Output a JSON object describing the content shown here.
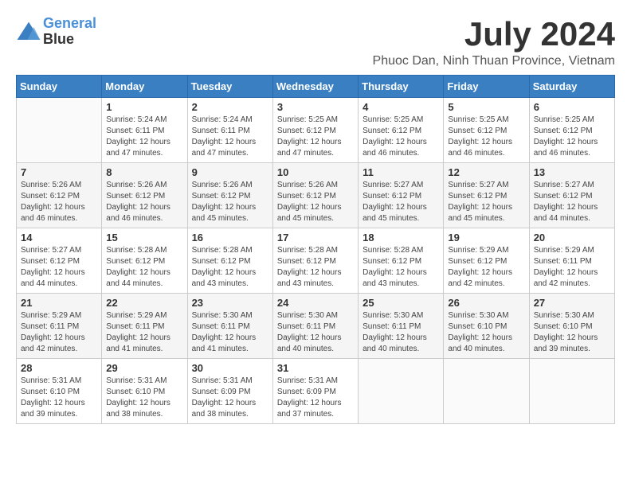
{
  "logo": {
    "line1": "General",
    "line2": "Blue"
  },
  "title": {
    "month_year": "July 2024",
    "location": "Phuoc Dan, Ninh Thuan Province, Vietnam"
  },
  "days_of_week": [
    "Sunday",
    "Monday",
    "Tuesday",
    "Wednesday",
    "Thursday",
    "Friday",
    "Saturday"
  ],
  "weeks": [
    [
      {
        "day": "",
        "info": ""
      },
      {
        "day": "1",
        "info": "Sunrise: 5:24 AM\nSunset: 6:11 PM\nDaylight: 12 hours\nand 47 minutes."
      },
      {
        "day": "2",
        "info": "Sunrise: 5:24 AM\nSunset: 6:11 PM\nDaylight: 12 hours\nand 47 minutes."
      },
      {
        "day": "3",
        "info": "Sunrise: 5:25 AM\nSunset: 6:12 PM\nDaylight: 12 hours\nand 47 minutes."
      },
      {
        "day": "4",
        "info": "Sunrise: 5:25 AM\nSunset: 6:12 PM\nDaylight: 12 hours\nand 46 minutes."
      },
      {
        "day": "5",
        "info": "Sunrise: 5:25 AM\nSunset: 6:12 PM\nDaylight: 12 hours\nand 46 minutes."
      },
      {
        "day": "6",
        "info": "Sunrise: 5:25 AM\nSunset: 6:12 PM\nDaylight: 12 hours\nand 46 minutes."
      }
    ],
    [
      {
        "day": "7",
        "info": "Sunrise: 5:26 AM\nSunset: 6:12 PM\nDaylight: 12 hours\nand 46 minutes."
      },
      {
        "day": "8",
        "info": "Sunrise: 5:26 AM\nSunset: 6:12 PM\nDaylight: 12 hours\nand 46 minutes."
      },
      {
        "day": "9",
        "info": "Sunrise: 5:26 AM\nSunset: 6:12 PM\nDaylight: 12 hours\nand 45 minutes."
      },
      {
        "day": "10",
        "info": "Sunrise: 5:26 AM\nSunset: 6:12 PM\nDaylight: 12 hours\nand 45 minutes."
      },
      {
        "day": "11",
        "info": "Sunrise: 5:27 AM\nSunset: 6:12 PM\nDaylight: 12 hours\nand 45 minutes."
      },
      {
        "day": "12",
        "info": "Sunrise: 5:27 AM\nSunset: 6:12 PM\nDaylight: 12 hours\nand 45 minutes."
      },
      {
        "day": "13",
        "info": "Sunrise: 5:27 AM\nSunset: 6:12 PM\nDaylight: 12 hours\nand 44 minutes."
      }
    ],
    [
      {
        "day": "14",
        "info": "Sunrise: 5:27 AM\nSunset: 6:12 PM\nDaylight: 12 hours\nand 44 minutes."
      },
      {
        "day": "15",
        "info": "Sunrise: 5:28 AM\nSunset: 6:12 PM\nDaylight: 12 hours\nand 44 minutes."
      },
      {
        "day": "16",
        "info": "Sunrise: 5:28 AM\nSunset: 6:12 PM\nDaylight: 12 hours\nand 43 minutes."
      },
      {
        "day": "17",
        "info": "Sunrise: 5:28 AM\nSunset: 6:12 PM\nDaylight: 12 hours\nand 43 minutes."
      },
      {
        "day": "18",
        "info": "Sunrise: 5:28 AM\nSunset: 6:12 PM\nDaylight: 12 hours\nand 43 minutes."
      },
      {
        "day": "19",
        "info": "Sunrise: 5:29 AM\nSunset: 6:12 PM\nDaylight: 12 hours\nand 42 minutes."
      },
      {
        "day": "20",
        "info": "Sunrise: 5:29 AM\nSunset: 6:11 PM\nDaylight: 12 hours\nand 42 minutes."
      }
    ],
    [
      {
        "day": "21",
        "info": "Sunrise: 5:29 AM\nSunset: 6:11 PM\nDaylight: 12 hours\nand 42 minutes."
      },
      {
        "day": "22",
        "info": "Sunrise: 5:29 AM\nSunset: 6:11 PM\nDaylight: 12 hours\nand 41 minutes."
      },
      {
        "day": "23",
        "info": "Sunrise: 5:30 AM\nSunset: 6:11 PM\nDaylight: 12 hours\nand 41 minutes."
      },
      {
        "day": "24",
        "info": "Sunrise: 5:30 AM\nSunset: 6:11 PM\nDaylight: 12 hours\nand 40 minutes."
      },
      {
        "day": "25",
        "info": "Sunrise: 5:30 AM\nSunset: 6:11 PM\nDaylight: 12 hours\nand 40 minutes."
      },
      {
        "day": "26",
        "info": "Sunrise: 5:30 AM\nSunset: 6:10 PM\nDaylight: 12 hours\nand 40 minutes."
      },
      {
        "day": "27",
        "info": "Sunrise: 5:30 AM\nSunset: 6:10 PM\nDaylight: 12 hours\nand 39 minutes."
      }
    ],
    [
      {
        "day": "28",
        "info": "Sunrise: 5:31 AM\nSunset: 6:10 PM\nDaylight: 12 hours\nand 39 minutes."
      },
      {
        "day": "29",
        "info": "Sunrise: 5:31 AM\nSunset: 6:10 PM\nDaylight: 12 hours\nand 38 minutes."
      },
      {
        "day": "30",
        "info": "Sunrise: 5:31 AM\nSunset: 6:09 PM\nDaylight: 12 hours\nand 38 minutes."
      },
      {
        "day": "31",
        "info": "Sunrise: 5:31 AM\nSunset: 6:09 PM\nDaylight: 12 hours\nand 37 minutes."
      },
      {
        "day": "",
        "info": ""
      },
      {
        "day": "",
        "info": ""
      },
      {
        "day": "",
        "info": ""
      }
    ]
  ]
}
